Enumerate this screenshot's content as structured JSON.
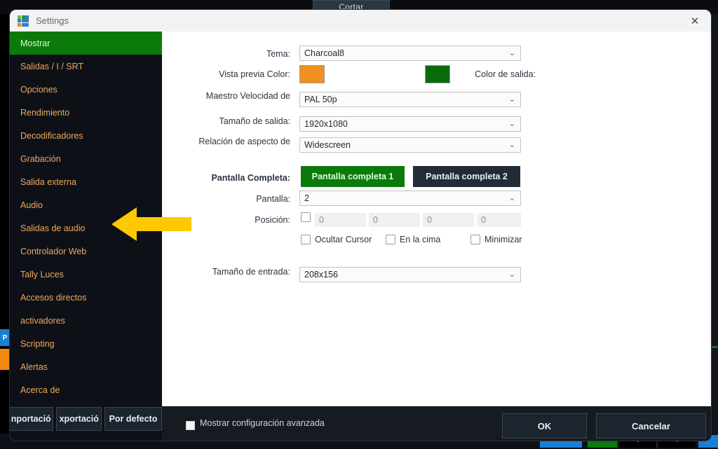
{
  "background": {
    "cortar_tab": "Cortar"
  },
  "window": {
    "title": "Settings",
    "icon": "app-grid-icon",
    "close_icon": "✕"
  },
  "sidebar": {
    "items": [
      {
        "label": "Mostrar",
        "selected": true
      },
      {
        "label": "Salidas / I / SRT",
        "selected": false
      },
      {
        "label": "Opciones",
        "selected": false
      },
      {
        "label": "Rendimiento",
        "selected": false
      },
      {
        "label": "Decodificadores",
        "selected": false
      },
      {
        "label": "Grabación",
        "selected": false
      },
      {
        "label": "Salida externa",
        "selected": false
      },
      {
        "label": "Audio",
        "selected": false
      },
      {
        "label": "Salidas de audio",
        "selected": false
      },
      {
        "label": "Controlador Web",
        "selected": false
      },
      {
        "label": "Tally Luces",
        "selected": false
      },
      {
        "label": "Accesos directos",
        "selected": false
      },
      {
        "label": "activadores",
        "selected": false
      },
      {
        "label": "Scripting",
        "selected": false
      },
      {
        "label": "Alertas",
        "selected": false
      },
      {
        "label": "Acerca de",
        "selected": false
      }
    ],
    "footer_buttons": [
      {
        "label": "nportació"
      },
      {
        "label": "xportació"
      },
      {
        "label": "Por defecto"
      }
    ]
  },
  "form": {
    "theme": {
      "label": "Tema:",
      "value": "Charcoal8"
    },
    "preview_color": {
      "label": "Vista previa Color:",
      "color": "#f0901e"
    },
    "output_color": {
      "label": "Color de salida:",
      "color": "#0a6b0a"
    },
    "master_speed": {
      "label": "Maestro Velocidad de",
      "value": "PAL 50p"
    },
    "output_size": {
      "label": "Tamaño de salida:",
      "value": "1920x1080"
    },
    "aspect_ratio": {
      "label": "Relación de aspecto de",
      "value": "Widescreen"
    },
    "fullscreen": {
      "label": "Pantalla Completa:",
      "button1": "Pantalla completa 1",
      "button2": "Pantalla completa 2"
    },
    "screen": {
      "label": "Pantalla:",
      "value": "2"
    },
    "position": {
      "label": "Posición:",
      "values": [
        "0",
        "0",
        "0",
        "0"
      ]
    },
    "checkboxes": [
      {
        "label": "Ocultar Cursor",
        "checked": false
      },
      {
        "label": "En la cima",
        "checked": false
      },
      {
        "label": "Minimizar",
        "checked": false
      }
    ],
    "input_size": {
      "label": "Tamaño de entrada:",
      "value": "208x156"
    }
  },
  "footer": {
    "advanced_label": "Mostrar configuración avanzada",
    "advanced_checked": false,
    "ok": "OK",
    "cancel": "Cancelar"
  },
  "annotation": {
    "arrow_color": "#FFC800",
    "direction": "left"
  },
  "colors": {
    "accent_green": "#0b7a0b",
    "sidebar_bg": "#0d1117",
    "dialog_bg": "#161b22",
    "content_bg": "#ffffff",
    "label_orange": "#f0a75f"
  }
}
